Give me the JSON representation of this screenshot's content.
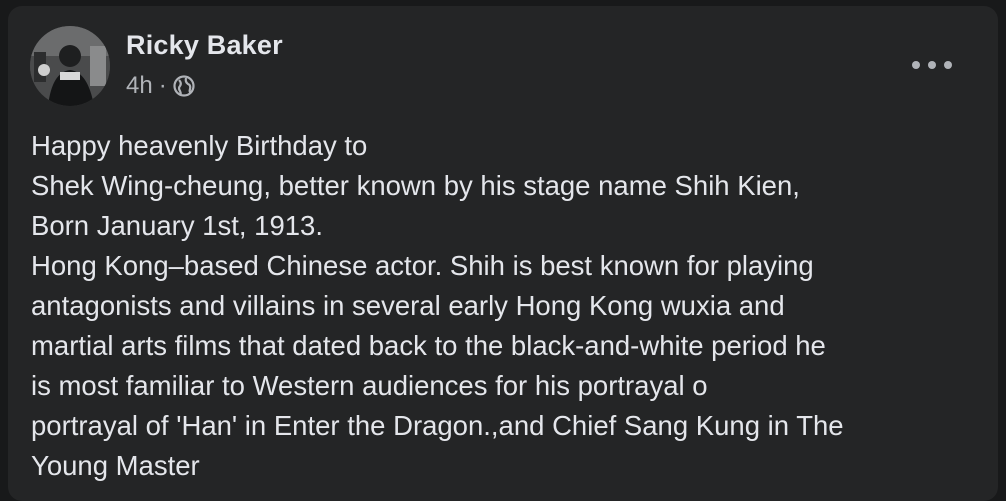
{
  "post": {
    "author": "Ricky Baker",
    "time": "4h",
    "separator": "·",
    "privacy_icon": "globe-icon",
    "more_icon": "more-options-icon",
    "lines": [
      "Happy heavenly Birthday to",
      "Shek Wing-cheung, better known by his stage name Shih Kien,",
      "Born January 1st, 1913.",
      "Hong Kong–based Chinese actor. Shih is best known for playing",
      "antagonists and villains in several early Hong Kong wuxia and",
      "martial arts films that dated back to the black-and-white period he",
      "is most familiar to Western audiences for his portrayal o",
      "portrayal of 'Han' in Enter the Dragon.,and Chief Sang Kung in The",
      "Young Master"
    ]
  },
  "colors": {
    "background": "#18191a",
    "card": "#242526",
    "primary_text": "#e4e6eb",
    "secondary_text": "#b0b3b8"
  }
}
